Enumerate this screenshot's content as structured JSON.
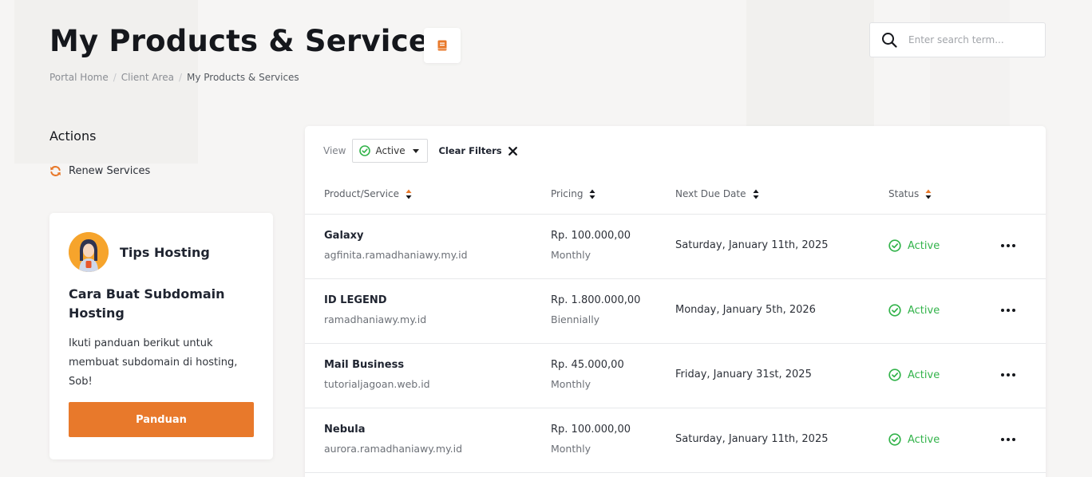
{
  "page": {
    "title": "My Products & Services",
    "breadcrumb": [
      "Portal Home",
      "Client Area",
      "My Products & Services"
    ]
  },
  "search": {
    "placeholder": "Enter search term..."
  },
  "sidebar": {
    "actions_title": "Actions",
    "renew_label": "Renew Services",
    "tips": {
      "label": "Tips Hosting",
      "heading": "Cara Buat Subdomain Hosting",
      "text": "Ikuti panduan berikut untuk membuat subdomain di hosting, Sob!",
      "button": "Panduan"
    }
  },
  "filters": {
    "view_label": "View",
    "view_value": "Active",
    "clear_label": "Clear Filters"
  },
  "table": {
    "headers": [
      "Product/Service",
      "Pricing",
      "Next Due Date",
      "Status"
    ],
    "rows": [
      {
        "name": "Galaxy",
        "domain": "agfinita.ramadhaniawy.my.id",
        "price": "Rp. 100.000,00",
        "cycle": "Monthly",
        "due": "Saturday, January 11th, 2025",
        "status": "Active"
      },
      {
        "name": "ID LEGEND",
        "domain": "ramadhaniawy.my.id",
        "price": "Rp. 1.800.000,00",
        "cycle": "Biennially",
        "due": "Monday, January 5th, 2026",
        "status": "Active"
      },
      {
        "name": "Mail Business",
        "domain": "tutorialjagoan.web.id",
        "price": "Rp. 45.000,00",
        "cycle": "Monthly",
        "due": "Friday, January 31st, 2025",
        "status": "Active"
      },
      {
        "name": "Nebula",
        "domain": "aurora.ramadhaniawy.my.id",
        "price": "Rp. 100.000,00",
        "cycle": "Monthly",
        "due": "Saturday, January 11th, 2025",
        "status": "Active"
      }
    ]
  },
  "colors": {
    "accent": "#e8792b",
    "status_active": "#32b34a"
  },
  "icons": [
    "book-icon",
    "search-icon",
    "refresh-icon",
    "check-circle-icon",
    "close-icon",
    "sort-icon",
    "more-icon"
  ]
}
